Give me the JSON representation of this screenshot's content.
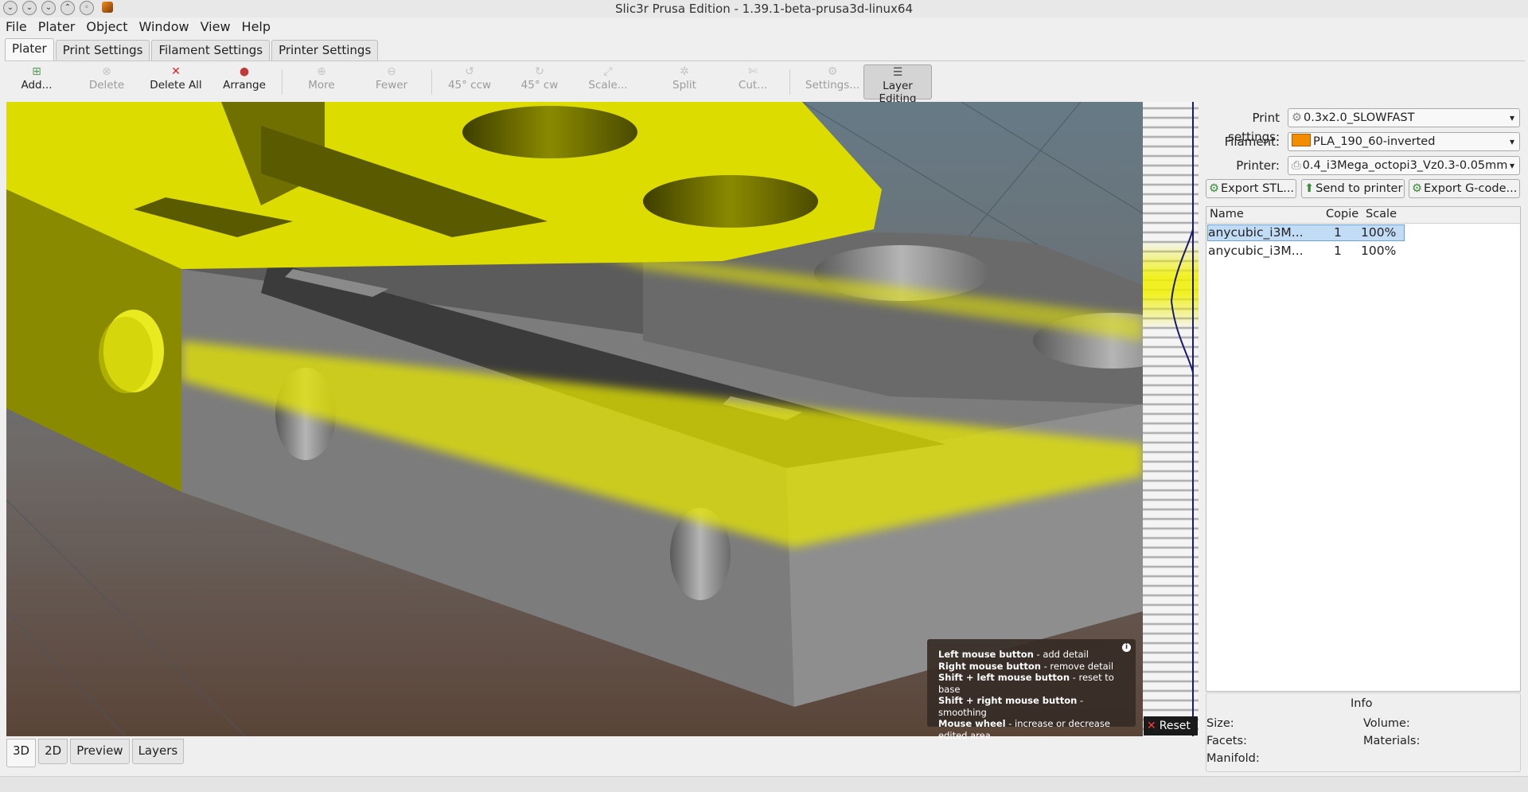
{
  "window": {
    "title": "Slic3r Prusa Edition - 1.39.1-beta-prusa3d-linux64"
  },
  "menubar": [
    "File",
    "Plater",
    "Object",
    "Window",
    "View",
    "Help"
  ],
  "tabs": [
    "Plater",
    "Print Settings",
    "Filament Settings",
    "Printer Settings"
  ],
  "toolbar": {
    "add": "Add...",
    "delete": "Delete",
    "delete_all": "Delete All",
    "arrange": "Arrange",
    "more": "More",
    "fewer": "Fewer",
    "rotate_ccw": "45° ccw",
    "rotate_cw": "45° cw",
    "scale": "Scale...",
    "split": "Split",
    "cut": "Cut...",
    "settings": "Settings...",
    "layer_editing": "Layer Editing"
  },
  "help": {
    "l1_bold": "Left mouse button",
    "l1": " - add detail",
    "l2_bold": "Right mouse button",
    "l2": " - remove detail",
    "l3_bold": "Shift + left mouse button",
    "l3": " - reset to base",
    "l4_bold": "Shift + right mouse button",
    "l4": " - smoothing",
    "l5_bold": "Mouse wheel",
    "l5": " - increase or decrease",
    "l6": "edited area"
  },
  "reset_label": "Reset",
  "bottom_tabs": [
    "3D",
    "2D",
    "Preview",
    "Layers"
  ],
  "sidebar": {
    "print_label": "Print settings:",
    "print_value": "0.3x2.0_SLOWFAST",
    "filament_label": "Filament:",
    "filament_value": "PLA_190_60-inverted",
    "filament_color": "#f28c00",
    "printer_label": "Printer:",
    "printer_value": "0.4_i3Mega_octopi3_Vz0.3-0.05mm",
    "export_stl": "Export STL...",
    "send_to_printer": "Send to printer",
    "export_gcode": "Export G-code..."
  },
  "object_list": {
    "columns": [
      "Name",
      "Copie",
      "Scale"
    ],
    "rows": [
      {
        "name": "anycubic_i3M...",
        "copies": "1",
        "scale": "100%"
      },
      {
        "name": "anycubic_i3M...",
        "copies": "1",
        "scale": "100%"
      }
    ]
  },
  "info": {
    "title": "Info",
    "size": "Size:",
    "volume": "Volume:",
    "facets": "Facets:",
    "materials": "Materials:",
    "manifold": "Manifold:"
  }
}
